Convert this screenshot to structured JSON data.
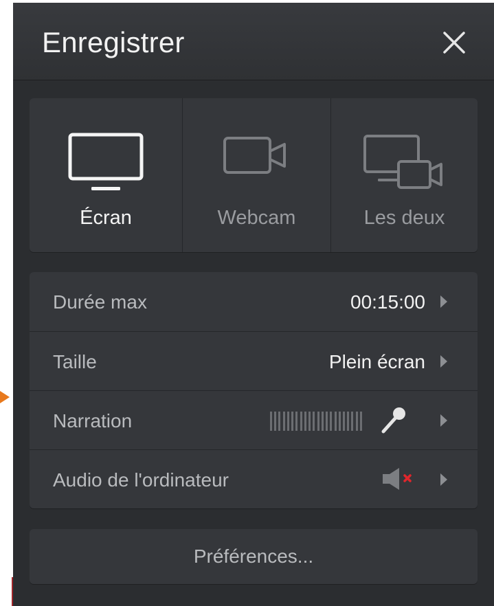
{
  "header": {
    "title": "Enregistrer"
  },
  "modes": [
    {
      "label": "Écran",
      "icon": "monitor-icon",
      "active": true
    },
    {
      "label": "Webcam",
      "icon": "video-camera-icon",
      "active": false
    },
    {
      "label": "Les deux",
      "icon": "screen-and-camera-icon",
      "active": false
    }
  ],
  "settings": {
    "max_duration": {
      "label": "Durée max",
      "value": "00:15:00"
    },
    "size": {
      "label": "Taille",
      "value": "Plein écran"
    },
    "narration": {
      "label": "Narration",
      "icon": "microphone-icon",
      "meter_level": 0
    },
    "computer_audio": {
      "label": "Audio de l'ordinateur",
      "icon": "speaker-muted-icon",
      "muted": true
    }
  },
  "preferences": {
    "label": "Préférences..."
  },
  "colors": {
    "panel": "#2b2d30",
    "card": "#35373b",
    "accent_arrow": "#e8791d",
    "mute_red": "#e0262c"
  }
}
